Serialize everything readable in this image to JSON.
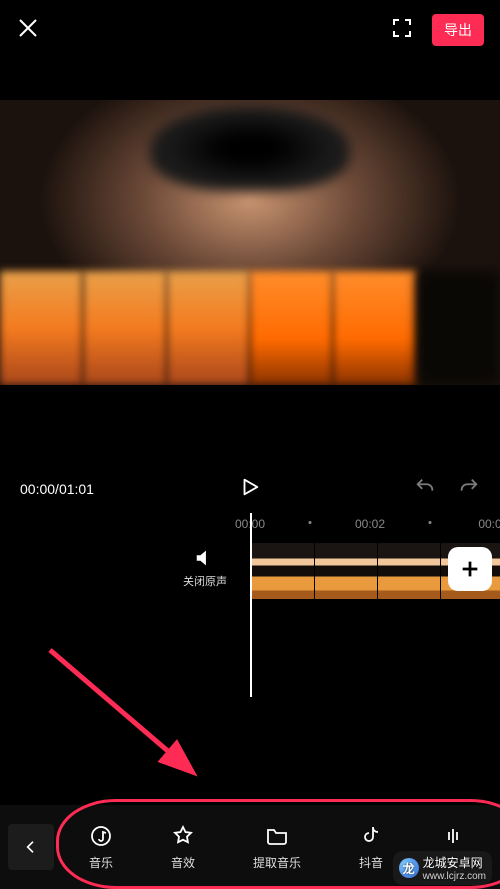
{
  "header": {
    "export_label": "导出"
  },
  "playback": {
    "current": "00:00",
    "total": "01:01"
  },
  "ruler": {
    "t0": "00:00",
    "t1": "00:02",
    "t2": "00:0"
  },
  "mute": {
    "label": "关闭原声"
  },
  "toolbar": {
    "items": [
      {
        "key": "music",
        "label": "音乐"
      },
      {
        "key": "sfx",
        "label": "音效"
      },
      {
        "key": "extract",
        "label": "提取音乐"
      },
      {
        "key": "douyin",
        "label": "抖音"
      }
    ]
  },
  "watermark": {
    "site": "龙城安卓网",
    "url": "www.lcjrz.com"
  }
}
